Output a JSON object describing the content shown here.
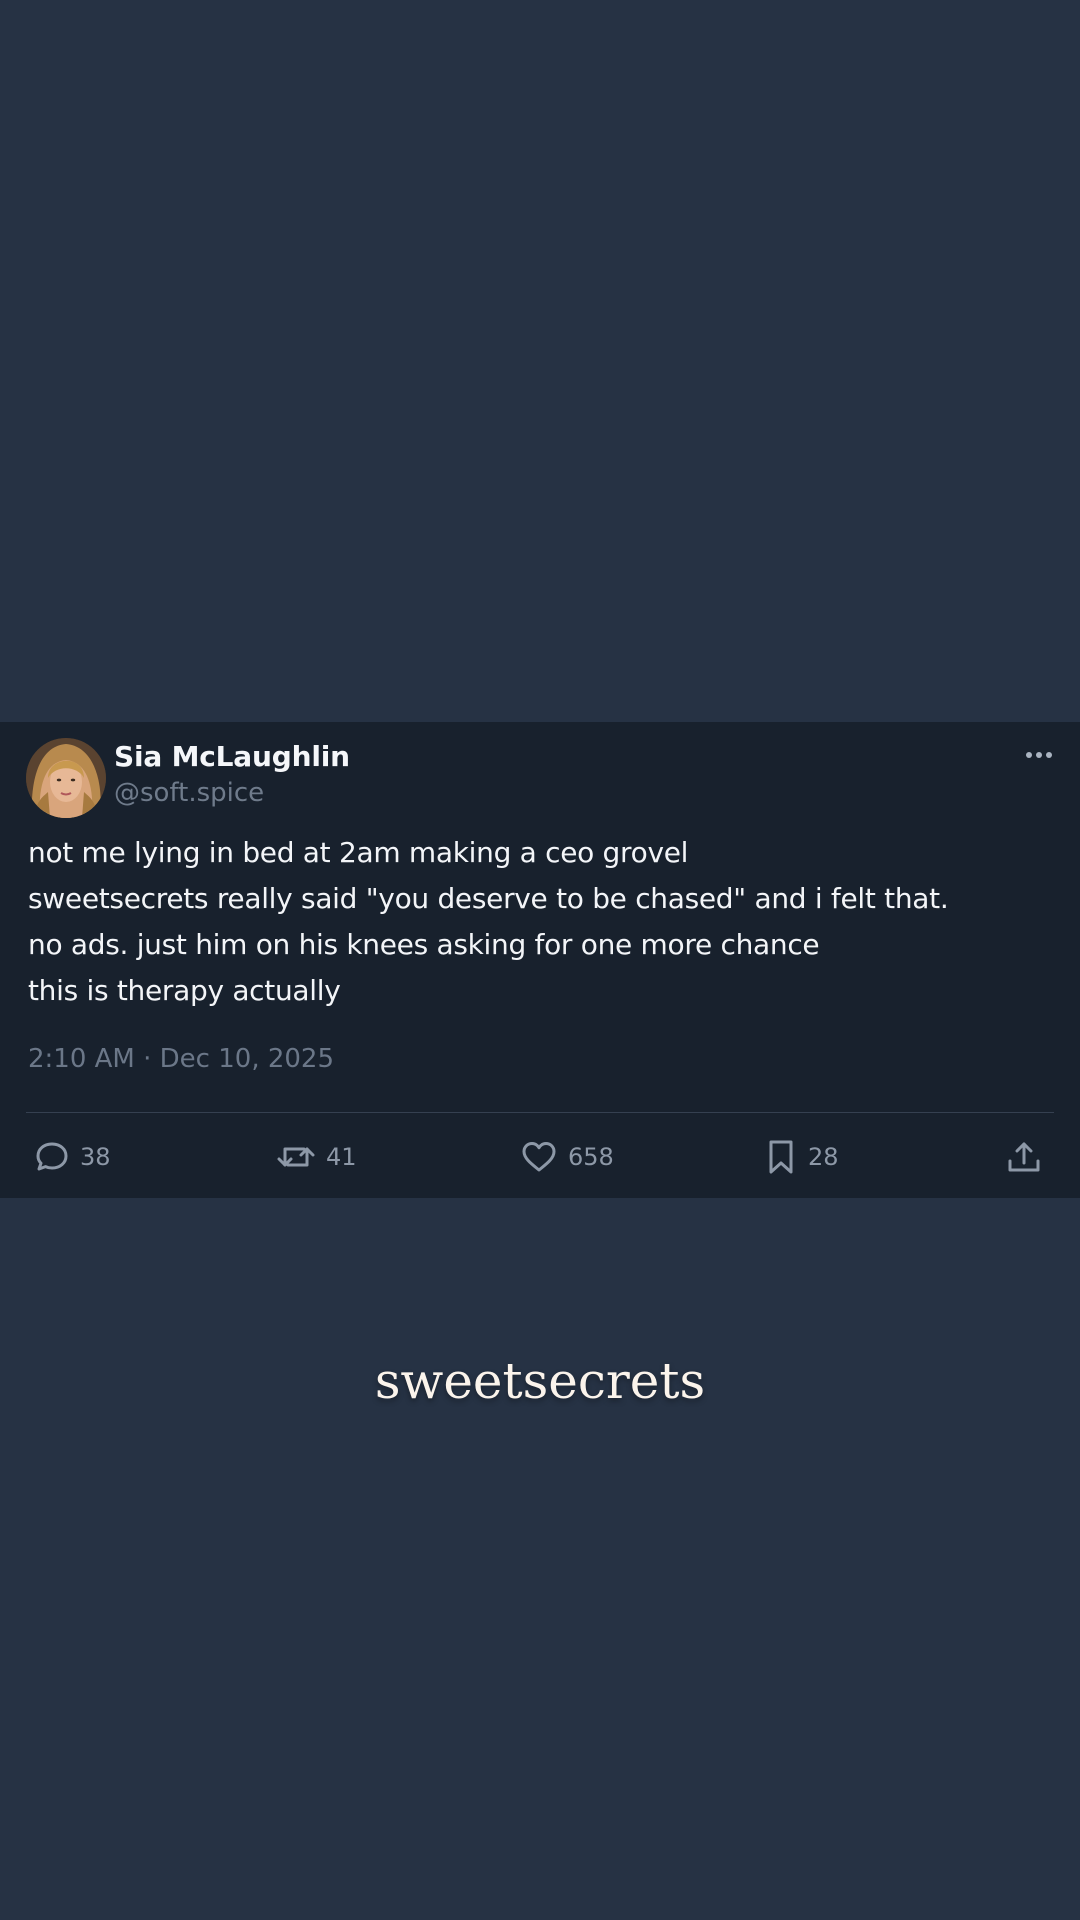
{
  "post": {
    "author": {
      "display_name": "Sia McLaughlin",
      "handle": "@soft.spice",
      "avatar_icon": "profile-photo"
    },
    "more_icon": "more-horizontal-icon",
    "body_lines": [
      "not me lying in bed at 2am making a ceo grovel",
      "sweetsecrets really said \"you deserve to be chased\" and i felt that.",
      "no ads. just him on his knees asking for one more chance",
      "this is therapy actually"
    ],
    "timestamp": "2:10 AM · Dec 10, 2025",
    "actions": {
      "reply": {
        "icon": "comment-bubble-icon",
        "count": "38"
      },
      "repost": {
        "icon": "repost-icon",
        "count": "41"
      },
      "like": {
        "icon": "heart-icon",
        "count": "658"
      },
      "bookmark": {
        "icon": "bookmark-icon",
        "count": "28"
      },
      "share": {
        "icon": "share-upload-icon"
      }
    }
  },
  "brand": {
    "logo_text": "sweetsecrets"
  },
  "colors": {
    "page_background": "#263244",
    "card_background": "#18212d",
    "text_primary": "#f3f5f8",
    "text_secondary": "#6f7b8b",
    "action_icon": "#8d98a7"
  }
}
